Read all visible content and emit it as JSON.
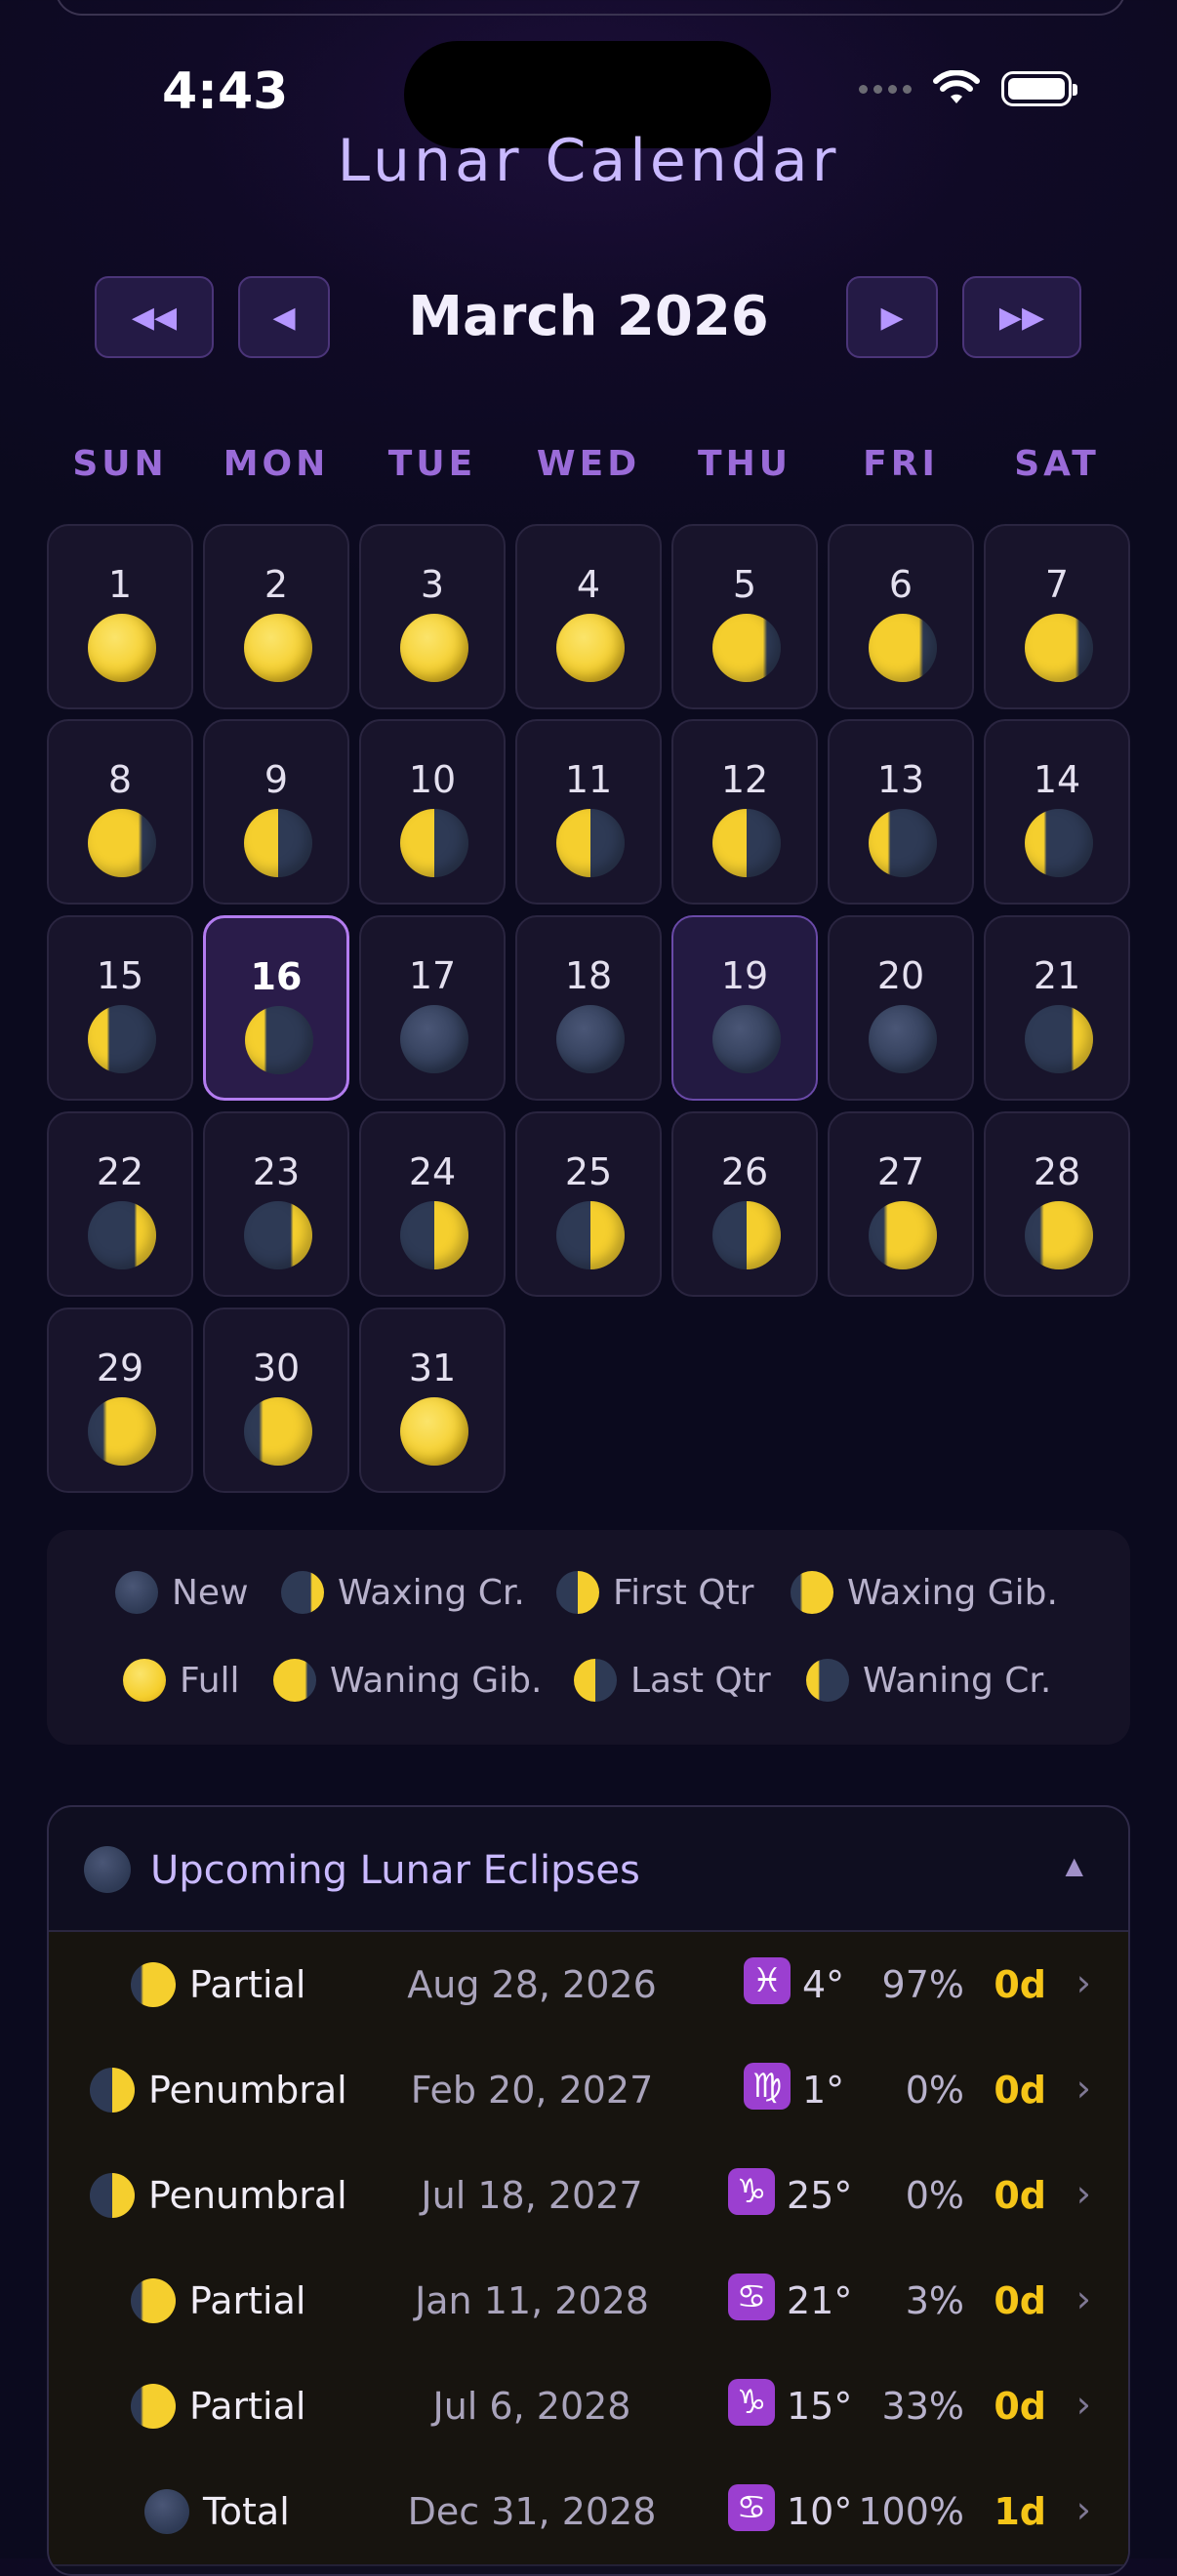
{
  "status_bar": {
    "time": "4:43"
  },
  "app": {
    "title": "Lunar Calendar"
  },
  "nav": {
    "prev_year": "◀◀",
    "prev_month": "◀",
    "month_title": "March 2026",
    "next_month": "▶",
    "next_year": "▶▶"
  },
  "weekdays": [
    "SUN",
    "MON",
    "TUE",
    "WED",
    "THU",
    "FRI",
    "SAT"
  ],
  "calendar": {
    "today_day": 16,
    "selected_day": 19,
    "first_weekday_index": 0,
    "days": [
      {
        "day": "1",
        "phase": "full"
      },
      {
        "day": "2",
        "phase": "full"
      },
      {
        "day": "3",
        "phase": "full"
      },
      {
        "day": "4",
        "phase": "full"
      },
      {
        "day": "5",
        "phase": "waning-gibbous"
      },
      {
        "day": "6",
        "phase": "waning-gibbous"
      },
      {
        "day": "7",
        "phase": "waning-gibbous"
      },
      {
        "day": "8",
        "phase": "waning-gibbous"
      },
      {
        "day": "9",
        "phase": "last-quarter"
      },
      {
        "day": "10",
        "phase": "last-quarter"
      },
      {
        "day": "11",
        "phase": "last-quarter"
      },
      {
        "day": "12",
        "phase": "last-quarter"
      },
      {
        "day": "13",
        "phase": "waning-crescent"
      },
      {
        "day": "14",
        "phase": "waning-crescent"
      },
      {
        "day": "15",
        "phase": "waning-crescent"
      },
      {
        "day": "16",
        "phase": "waning-crescent"
      },
      {
        "day": "17",
        "phase": "new"
      },
      {
        "day": "18",
        "phase": "new"
      },
      {
        "day": "19",
        "phase": "new"
      },
      {
        "day": "20",
        "phase": "new"
      },
      {
        "day": "21",
        "phase": "waxing-crescent"
      },
      {
        "day": "22",
        "phase": "waxing-crescent"
      },
      {
        "day": "23",
        "phase": "waxing-crescent"
      },
      {
        "day": "24",
        "phase": "first-quarter"
      },
      {
        "day": "25",
        "phase": "first-quarter"
      },
      {
        "day": "26",
        "phase": "first-quarter"
      },
      {
        "day": "27",
        "phase": "waxing-gibbous"
      },
      {
        "day": "28",
        "phase": "waxing-gibbous"
      },
      {
        "day": "29",
        "phase": "waxing-gibbous"
      },
      {
        "day": "30",
        "phase": "waxing-gibbous"
      },
      {
        "day": "31",
        "phase": "full"
      }
    ]
  },
  "legend": [
    {
      "label": "New",
      "phase": "new"
    },
    {
      "label": "Waxing Cr.",
      "phase": "waxing-crescent"
    },
    {
      "label": "First Qtr",
      "phase": "first-quarter"
    },
    {
      "label": "Waxing Gib.",
      "phase": "waxing-gibbous"
    },
    {
      "label": "Full",
      "phase": "full"
    },
    {
      "label": "Waning Gib.",
      "phase": "waning-gibbous"
    },
    {
      "label": "Last Qtr",
      "phase": "last-quarter"
    },
    {
      "label": "Waning Cr.",
      "phase": "waning-crescent"
    }
  ],
  "eclipses": {
    "title": "Upcoming Lunar Eclipses",
    "collapse_icon": "▲",
    "rows": [
      {
        "type": "Partial",
        "date": "Aug 28, 2026",
        "zodiac": "♓",
        "degree": "4°",
        "percent": "97%",
        "duration": "0d",
        "icon_phase": "waxing-gibbous"
      },
      {
        "type": "Penumbral",
        "date": "Feb 20, 2027",
        "zodiac": "♍",
        "degree": "1°",
        "percent": "0%",
        "duration": "0d",
        "icon_phase": "first-quarter"
      },
      {
        "type": "Penumbral",
        "date": "Jul 18, 2027",
        "zodiac": "♑",
        "degree": "25°",
        "percent": "0%",
        "duration": "0d",
        "icon_phase": "first-quarter"
      },
      {
        "type": "Partial",
        "date": "Jan 11, 2028",
        "zodiac": "♋",
        "degree": "21°",
        "percent": "3%",
        "duration": "0d",
        "icon_phase": "waxing-gibbous"
      },
      {
        "type": "Partial",
        "date": "Jul 6, 2028",
        "zodiac": "♑",
        "degree": "15°",
        "percent": "33%",
        "duration": "0d",
        "icon_phase": "waxing-gibbous"
      },
      {
        "type": "Total",
        "date": "Dec 31, 2028",
        "zodiac": "♋",
        "degree": "10°",
        "percent": "100%",
        "duration": "1d",
        "icon_phase": "new"
      }
    ]
  },
  "colors": {
    "accent": "#b37cf0",
    "moon_lit": "#f5cf2e",
    "moon_dark": "#2e3a55",
    "duration": "#f5c518",
    "zodiac_badge": "#9b3fd0"
  }
}
